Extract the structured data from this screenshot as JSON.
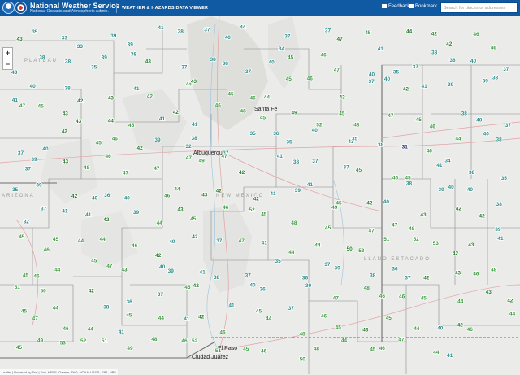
{
  "header": {
    "title": "National Weather Service",
    "subtitle": "National Oceanic and Atmospheric Admin.",
    "app_title": "WEATHER & HAZARDS DATA VIEWER",
    "feedback_label": "Feedback",
    "bookmark_label": "Bookmark",
    "search_placeholder": "Search for places or addresses"
  },
  "map": {
    "zoom_in": "+",
    "zoom_out": "−",
    "attribution": "Leaflet | Powered by Esri | Esri, HERE, Garmin, FAO, NOAA, USGS, EPA, NPS",
    "place_labels": {
      "albuquerque": "Albuquerque",
      "new_mexico": "NEW MEXICO",
      "arizona": "ARIZONA",
      "ciudad_juarez": "Ciudad Juárez",
      "el_paso": "El Paso",
      "santa_fe": "Santa Fe",
      "llano_estacado": "LLANO ESTACADO",
      "colorado_plateau": "PLATEAU"
    },
    "station_colors": {
      "dark_green": "#2b7a2e",
      "green": "#3d9a3f",
      "teal": "#2a8c88",
      "navy": "#1b2a6b",
      "black": "#222222"
    },
    "stations": [
      {
        "v": "43",
        "c": "dark_green"
      },
      {
        "v": "35",
        "c": "teal"
      },
      {
        "v": "33",
        "c": "teal"
      },
      {
        "v": "33",
        "c": "teal"
      },
      {
        "v": "39",
        "c": "teal"
      },
      {
        "v": "39",
        "c": "teal"
      },
      {
        "v": "41",
        "c": "teal"
      },
      {
        "v": "38",
        "c": "teal"
      },
      {
        "v": "37",
        "c": "teal"
      },
      {
        "v": "40",
        "c": "teal"
      },
      {
        "v": "44",
        "c": "teal"
      },
      {
        "v": "34",
        "c": "teal"
      },
      {
        "v": "37",
        "c": "teal"
      },
      {
        "v": "37",
        "c": "teal"
      },
      {
        "v": "47",
        "c": "dark_green"
      },
      {
        "v": "45",
        "c": "green"
      },
      {
        "v": "41",
        "c": "teal"
      },
      {
        "v": "44",
        "c": "dark_green"
      },
      {
        "v": "42",
        "c": "dark_green"
      },
      {
        "v": "42",
        "c": "dark_green"
      },
      {
        "v": "46",
        "c": "green"
      },
      {
        "v": "46",
        "c": "green"
      },
      {
        "v": "43",
        "c": "teal"
      },
      {
        "v": "38",
        "c": "teal"
      },
      {
        "v": "38",
        "c": "teal"
      },
      {
        "v": "35",
        "c": "teal"
      },
      {
        "v": "39",
        "c": "teal"
      },
      {
        "v": "38",
        "c": "teal"
      },
      {
        "v": "43",
        "c": "dark_green"
      },
      {
        "v": "37",
        "c": "teal"
      },
      {
        "v": "38",
        "c": "teal"
      },
      {
        "v": "38",
        "c": "teal"
      },
      {
        "v": "37",
        "c": "teal"
      },
      {
        "v": "40",
        "c": "teal"
      },
      {
        "v": "45",
        "c": "green"
      },
      {
        "v": "46",
        "c": "green"
      },
      {
        "v": "47",
        "c": "green"
      },
      {
        "v": "40",
        "c": "teal"
      },
      {
        "v": "35",
        "c": "teal"
      },
      {
        "v": "37",
        "c": "teal"
      },
      {
        "v": "38",
        "c": "teal"
      },
      {
        "v": "36",
        "c": "teal"
      },
      {
        "v": "40",
        "c": "teal"
      },
      {
        "v": "37",
        "c": "teal"
      },
      {
        "v": "41",
        "c": "teal"
      },
      {
        "v": "40",
        "c": "teal"
      },
      {
        "v": "38",
        "c": "teal"
      },
      {
        "v": "42",
        "c": "dark_green"
      },
      {
        "v": "43",
        "c": "dark_green"
      },
      {
        "v": "41",
        "c": "teal"
      },
      {
        "v": "42",
        "c": "green"
      },
      {
        "v": "44",
        "c": "green"
      },
      {
        "v": "43",
        "c": "dark_green"
      },
      {
        "v": "45",
        "c": "green"
      },
      {
        "v": "46",
        "c": "green"
      },
      {
        "v": "44",
        "c": "green"
      },
      {
        "v": "45",
        "c": "green"
      },
      {
        "v": "46",
        "c": "green"
      },
      {
        "v": "42",
        "c": "dark_green"
      },
      {
        "v": "37",
        "c": "teal"
      },
      {
        "v": "40",
        "c": "teal"
      },
      {
        "v": "42",
        "c": "dark_green"
      },
      {
        "v": "41",
        "c": "teal"
      },
      {
        "v": "39",
        "c": "teal"
      },
      {
        "v": "39",
        "c": "teal"
      },
      {
        "v": "38",
        "c": "teal"
      },
      {
        "v": "47",
        "c": "green"
      },
      {
        "v": "45",
        "c": "green"
      },
      {
        "v": "43",
        "c": "dark_green"
      },
      {
        "v": "43",
        "c": "dark_green"
      },
      {
        "v": "44",
        "c": "dark_green"
      },
      {
        "v": "45",
        "c": "green"
      },
      {
        "v": "41",
        "c": "teal"
      },
      {
        "v": "42",
        "c": "dark_green"
      },
      {
        "v": "41",
        "c": "teal"
      },
      {
        "v": "46",
        "c": "green"
      },
      {
        "v": "48",
        "c": "green"
      },
      {
        "v": "45",
        "c": "green"
      },
      {
        "v": "49",
        "c": "dark_green"
      },
      {
        "v": "52",
        "c": "green"
      },
      {
        "v": "45",
        "c": "green"
      },
      {
        "v": "48",
        "c": "green"
      },
      {
        "v": "47",
        "c": "green"
      },
      {
        "v": "45",
        "c": "green"
      },
      {
        "v": "46",
        "c": "green"
      },
      {
        "v": "38",
        "c": "teal"
      },
      {
        "v": "40",
        "c": "teal"
      },
      {
        "v": "37",
        "c": "teal"
      },
      {
        "v": "37",
        "c": "teal"
      },
      {
        "v": "40",
        "c": "teal"
      },
      {
        "v": "42",
        "c": "dark_green"
      },
      {
        "v": "45",
        "c": "green"
      },
      {
        "v": "46",
        "c": "green"
      },
      {
        "v": "42",
        "c": "dark_green"
      },
      {
        "v": "39",
        "c": "teal"
      },
      {
        "v": "32",
        "c": "teal"
      },
      {
        "v": "38",
        "c": "teal"
      },
      {
        "v": "37",
        "c": "teal"
      },
      {
        "v": "35",
        "c": "teal"
      },
      {
        "v": "36",
        "c": "teal"
      },
      {
        "v": "35",
        "c": "teal"
      },
      {
        "v": "40",
        "c": "teal"
      },
      {
        "v": "41",
        "c": "teal"
      },
      {
        "v": "35",
        "c": "teal"
      },
      {
        "v": "38",
        "c": "teal"
      },
      {
        "v": "31",
        "c": "navy"
      },
      {
        "v": "46",
        "c": "green"
      },
      {
        "v": "44",
        "c": "green"
      },
      {
        "v": "40",
        "c": "teal"
      },
      {
        "v": "38",
        "c": "teal"
      },
      {
        "v": "37",
        "c": "teal"
      },
      {
        "v": "39",
        "c": "teal"
      },
      {
        "v": "43",
        "c": "dark_green"
      },
      {
        "v": "48",
        "c": "green"
      },
      {
        "v": "46",
        "c": "green"
      },
      {
        "v": "47",
        "c": "green"
      },
      {
        "v": "47",
        "c": "green"
      },
      {
        "v": "47",
        "c": "green"
      },
      {
        "v": "49",
        "c": "green"
      },
      {
        "v": "47",
        "c": "green"
      },
      {
        "v": "42",
        "c": "dark_green"
      },
      {
        "v": "41",
        "c": "teal"
      },
      {
        "v": "38",
        "c": "teal"
      },
      {
        "v": "37",
        "c": "teal"
      },
      {
        "v": "37",
        "c": "teal"
      },
      {
        "v": "45",
        "c": "green"
      },
      {
        "v": "46",
        "c": "green"
      },
      {
        "v": "45",
        "c": "green"
      },
      {
        "v": "41",
        "c": "teal"
      },
      {
        "v": "34",
        "c": "teal"
      },
      {
        "v": "38",
        "c": "teal"
      },
      {
        "v": "35",
        "c": "teal"
      },
      {
        "v": "35",
        "c": "teal"
      },
      {
        "v": "39",
        "c": "teal"
      },
      {
        "v": "42",
        "c": "dark_green"
      },
      {
        "v": "40",
        "c": "teal"
      },
      {
        "v": "36",
        "c": "teal"
      },
      {
        "v": "40",
        "c": "teal"
      },
      {
        "v": "46",
        "c": "green"
      },
      {
        "v": "44",
        "c": "green"
      },
      {
        "v": "43",
        "c": "dark_green"
      },
      {
        "v": "42",
        "c": "dark_green"
      },
      {
        "v": "42",
        "c": "dark_green"
      },
      {
        "v": "41",
        "c": "teal"
      },
      {
        "v": "39",
        "c": "teal"
      },
      {
        "v": "41",
        "c": "teal"
      },
      {
        "v": "45",
        "c": "green"
      },
      {
        "v": "42",
        "c": "dark_green"
      },
      {
        "v": "40",
        "c": "teal"
      },
      {
        "v": "38",
        "c": "teal"
      },
      {
        "v": "39",
        "c": "teal"
      },
      {
        "v": "40",
        "c": "teal"
      },
      {
        "v": "40",
        "c": "teal"
      },
      {
        "v": "38",
        "c": "teal"
      },
      {
        "v": "32",
        "c": "teal"
      },
      {
        "v": "37",
        "c": "teal"
      },
      {
        "v": "41",
        "c": "teal"
      },
      {
        "v": "41",
        "c": "teal"
      },
      {
        "v": "42",
        "c": "dark_green"
      },
      {
        "v": "39",
        "c": "teal"
      },
      {
        "v": "44",
        "c": "green"
      },
      {
        "v": "43",
        "c": "dark_green"
      },
      {
        "v": "45",
        "c": "green"
      },
      {
        "v": "46",
        "c": "green"
      },
      {
        "v": "52",
        "c": "green"
      },
      {
        "v": "45",
        "c": "green"
      },
      {
        "v": "48",
        "c": "green"
      },
      {
        "v": "45",
        "c": "green"
      },
      {
        "v": "49",
        "c": "green"
      },
      {
        "v": "47",
        "c": "green"
      },
      {
        "v": "47",
        "c": "green"
      },
      {
        "v": "48",
        "c": "green"
      },
      {
        "v": "43",
        "c": "dark_green"
      },
      {
        "v": "42",
        "c": "dark_green"
      },
      {
        "v": "42",
        "c": "dark_green"
      },
      {
        "v": "39",
        "c": "teal"
      },
      {
        "v": "45",
        "c": "green"
      },
      {
        "v": "46",
        "c": "green"
      },
      {
        "v": "45",
        "c": "green"
      },
      {
        "v": "44",
        "c": "green"
      },
      {
        "v": "44",
        "c": "green"
      },
      {
        "v": "46",
        "c": "green"
      },
      {
        "v": "42",
        "c": "dark_green"
      },
      {
        "v": "40",
        "c": "teal"
      },
      {
        "v": "42",
        "c": "dark_green"
      },
      {
        "v": "37",
        "c": "teal"
      },
      {
        "v": "47",
        "c": "green"
      },
      {
        "v": "41",
        "c": "teal"
      },
      {
        "v": "44",
        "c": "green"
      },
      {
        "v": "44",
        "c": "green"
      },
      {
        "v": "50",
        "c": "dark_green"
      },
      {
        "v": "53",
        "c": "green"
      },
      {
        "v": "51",
        "c": "green"
      },
      {
        "v": "52",
        "c": "green"
      },
      {
        "v": "53",
        "c": "green"
      },
      {
        "v": "42",
        "c": "dark_green"
      },
      {
        "v": "43",
        "c": "dark_green"
      },
      {
        "v": "41",
        "c": "teal"
      },
      {
        "v": "45",
        "c": "green"
      },
      {
        "v": "46",
        "c": "green"
      },
      {
        "v": "44",
        "c": "green"
      },
      {
        "v": "45",
        "c": "green"
      },
      {
        "v": "47",
        "c": "green"
      },
      {
        "v": "43",
        "c": "dark_green"
      },
      {
        "v": "40",
        "c": "teal"
      },
      {
        "v": "39",
        "c": "teal"
      },
      {
        "v": "41",
        "c": "teal"
      },
      {
        "v": "38",
        "c": "teal"
      },
      {
        "v": "37",
        "c": "teal"
      },
      {
        "v": "35",
        "c": "teal"
      },
      {
        "v": "36",
        "c": "teal"
      },
      {
        "v": "37",
        "c": "teal"
      },
      {
        "v": "39",
        "c": "teal"
      },
      {
        "v": "38",
        "c": "teal"
      },
      {
        "v": "36",
        "c": "teal"
      },
      {
        "v": "37",
        "c": "teal"
      },
      {
        "v": "42",
        "c": "dark_green"
      },
      {
        "v": "43",
        "c": "dark_green"
      },
      {
        "v": "46",
        "c": "green"
      },
      {
        "v": "48",
        "c": "green"
      },
      {
        "v": "51",
        "c": "green"
      },
      {
        "v": "50",
        "c": "green"
      },
      {
        "v": "44",
        "c": "green"
      },
      {
        "v": "42",
        "c": "dark_green"
      },
      {
        "v": "38",
        "c": "teal"
      },
      {
        "v": "36",
        "c": "teal"
      },
      {
        "v": "37",
        "c": "teal"
      },
      {
        "v": "45",
        "c": "green"
      },
      {
        "v": "42",
        "c": "dark_green"
      },
      {
        "v": "41",
        "c": "teal"
      },
      {
        "v": "40",
        "c": "teal"
      },
      {
        "v": "36",
        "c": "teal"
      },
      {
        "v": "37",
        "c": "teal"
      },
      {
        "v": "39",
        "c": "teal"
      },
      {
        "v": "47",
        "c": "green"
      },
      {
        "v": "48",
        "c": "green"
      },
      {
        "v": "46",
        "c": "green"
      },
      {
        "v": "46",
        "c": "green"
      },
      {
        "v": "45",
        "c": "green"
      },
      {
        "v": "44",
        "c": "green"
      },
      {
        "v": "43",
        "c": "dark_green"
      },
      {
        "v": "42",
        "c": "dark_green"
      },
      {
        "v": "45",
        "c": "green"
      },
      {
        "v": "47",
        "c": "green"
      },
      {
        "v": "46",
        "c": "green"
      },
      {
        "v": "44",
        "c": "green"
      },
      {
        "v": "41",
        "c": "teal"
      },
      {
        "v": "45",
        "c": "green"
      },
      {
        "v": "44",
        "c": "green"
      },
      {
        "v": "41",
        "c": "teal"
      },
      {
        "v": "42",
        "c": "dark_green"
      },
      {
        "v": "46",
        "c": "green"
      },
      {
        "v": "45",
        "c": "green"
      },
      {
        "v": "44",
        "c": "green"
      },
      {
        "v": "48",
        "c": "green"
      },
      {
        "v": "46",
        "c": "green"
      },
      {
        "v": "45",
        "c": "green"
      },
      {
        "v": "43",
        "c": "dark_green"
      },
      {
        "v": "45",
        "c": "green"
      },
      {
        "v": "44",
        "c": "green"
      },
      {
        "v": "40",
        "c": "teal"
      },
      {
        "v": "42",
        "c": "dark_green"
      },
      {
        "v": "46",
        "c": "green"
      },
      {
        "v": "44",
        "c": "green"
      },
      {
        "v": "45",
        "c": "green"
      },
      {
        "v": "49",
        "c": "green"
      },
      {
        "v": "53",
        "c": "green"
      },
      {
        "v": "52",
        "c": "green"
      },
      {
        "v": "51",
        "c": "green"
      },
      {
        "v": "49",
        "c": "green"
      },
      {
        "v": "48",
        "c": "green"
      },
      {
        "v": "46",
        "c": "green"
      },
      {
        "v": "52",
        "c": "green"
      },
      {
        "v": "51",
        "c": "green"
      },
      {
        "v": "45",
        "c": "green"
      },
      {
        "v": "46",
        "c": "green"
      },
      {
        "v": "50",
        "c": "green"
      },
      {
        "v": "48",
        "c": "green"
      },
      {
        "v": "44",
        "c": "green"
      },
      {
        "v": "45",
        "c": "green"
      },
      {
        "v": "46",
        "c": "green"
      },
      {
        "v": "47",
        "c": "green"
      },
      {
        "v": "44",
        "c": "green"
      },
      {
        "v": "41",
        "c": "teal"
      }
    ]
  }
}
